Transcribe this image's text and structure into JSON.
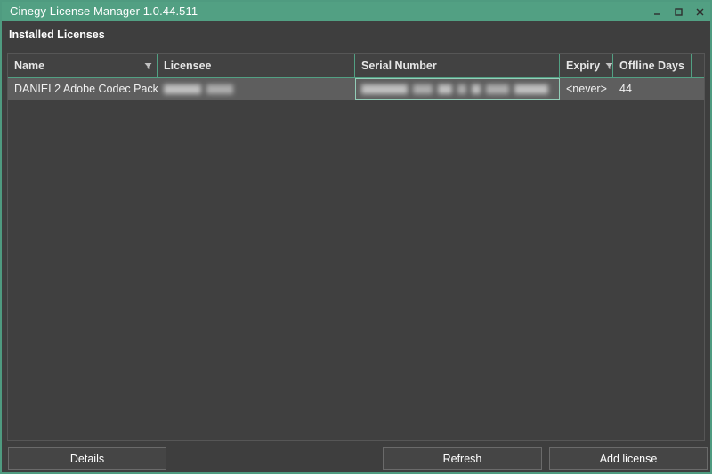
{
  "window": {
    "title": "Cinegy License Manager 1.0.44.511",
    "accent_color": "#52a083",
    "background_color": "#3e3e3e",
    "controls": [
      {
        "name": "minimize",
        "glyph": "minimize-icon"
      },
      {
        "name": "maximize",
        "glyph": "maximize-icon"
      },
      {
        "name": "close",
        "glyph": "close-icon"
      }
    ]
  },
  "section": {
    "title": "Installed Licenses"
  },
  "grid": {
    "columns": [
      {
        "key": "name",
        "label": "Name",
        "filterable": true
      },
      {
        "key": "licensee",
        "label": "Licensee",
        "filterable": false
      },
      {
        "key": "serial",
        "label": "Serial Number",
        "filterable": false
      },
      {
        "key": "expiry",
        "label": "Expiry",
        "filterable": true
      },
      {
        "key": "offline",
        "label": "Offline Days",
        "filterable": false
      }
    ],
    "rows": [
      {
        "name": "DANIEL2 Adobe Codec Pack",
        "name_redacted": true,
        "licensee": "",
        "licensee_redacted": true,
        "serial": "",
        "serial_redacted": true,
        "serial_focused": true,
        "expiry": "<never>",
        "offline": "44",
        "selected": true
      }
    ]
  },
  "footer": {
    "details_label": "Details",
    "refresh_label": "Refresh",
    "add_license_label": "Add license"
  }
}
